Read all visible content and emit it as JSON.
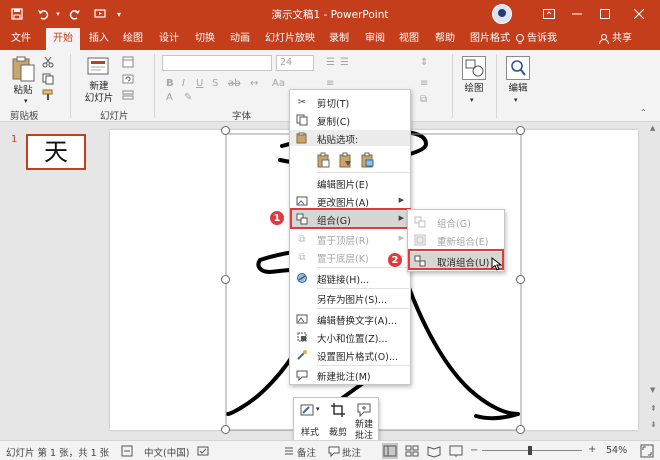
{
  "window": {
    "title": "演示文稿1 - PowerPoint"
  },
  "tabs": [
    {
      "label": "文件"
    },
    {
      "label": "开始"
    },
    {
      "label": "插入"
    },
    {
      "label": "绘图"
    },
    {
      "label": "设计"
    },
    {
      "label": "切换"
    },
    {
      "label": "动画"
    },
    {
      "label": "幻灯片放映"
    },
    {
      "label": "录制"
    },
    {
      "label": "审阅"
    },
    {
      "label": "视图"
    },
    {
      "label": "帮助"
    },
    {
      "label": "图片格式"
    }
  ],
  "tell_me": "告诉我",
  "share": "共享",
  "ribbon": {
    "paste_label": "粘贴",
    "new_slide_label": "新建\n幻灯片",
    "clipboard_group": "剪贴板",
    "slides_group": "幻灯片",
    "font_group": "字体",
    "font_size": "24",
    "drawing_label": "绘图",
    "editing_label": "编辑"
  },
  "thumbnail": {
    "number": "1",
    "glyph": "天"
  },
  "context_menu": {
    "cut": "剪切(T)",
    "copy": "复制(C)",
    "paste_options": "粘贴选项:",
    "edit_picture": "编辑图片(E)",
    "change_picture": "更改图片(A)",
    "group": "组合(G)",
    "bring_to_front": "置于顶层(R)",
    "send_to_back": "置于底层(K)",
    "hyperlink": "超链接(H)...",
    "save_as_picture": "另存为图片(S)...",
    "edit_alt_text": "编辑替换文字(A)...",
    "size_position": "大小和位置(Z)...",
    "format_picture": "设置图片格式(O)...",
    "new_comment": "新建批注(M)"
  },
  "submenu": {
    "group": "组合(G)",
    "regroup": "重新组合(E)",
    "ungroup": "取消组合(U)"
  },
  "badges": {
    "one": "1",
    "two": "2"
  },
  "mini_toolbar": {
    "style": "样式",
    "crop": "裁剪",
    "new_comment": "新建\n批注"
  },
  "status_bar": {
    "slide_info": "幻灯片 第 1 张，共 1 张",
    "language": "中文(中国)",
    "notes": "备注",
    "comments": "批注",
    "zoom": "54%"
  },
  "colors": {
    "accent": "#c43e1c",
    "highlight_box": "#e03a3a"
  }
}
